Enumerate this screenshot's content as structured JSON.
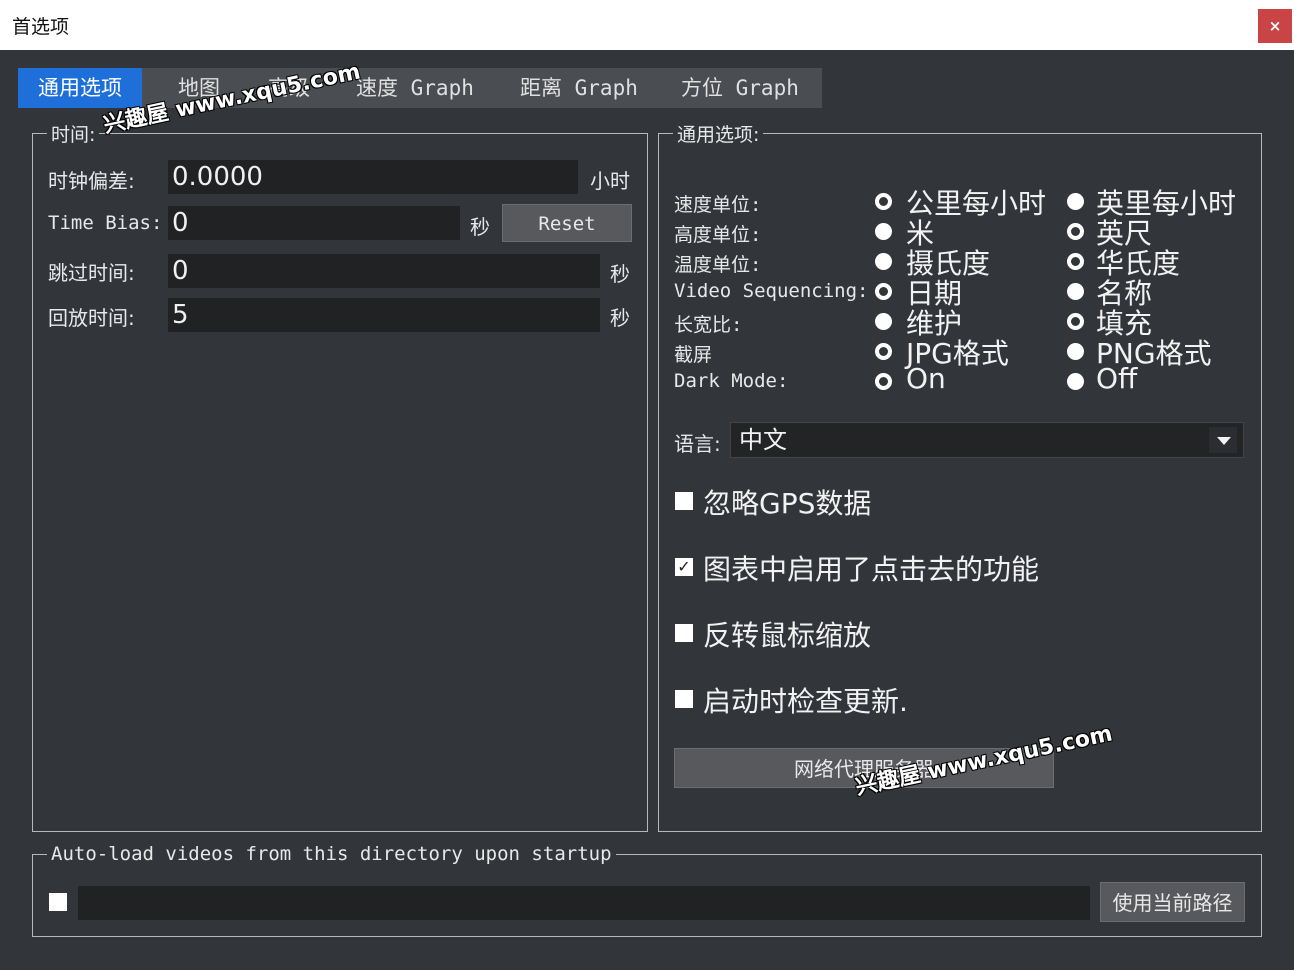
{
  "window": {
    "title": "首选项",
    "close_icon": "×"
  },
  "tabs": [
    "通用选项",
    "地图",
    "高级",
    "速度 Graph",
    "距离 Graph",
    "方位 Graph"
  ],
  "time_group": {
    "legend": "时间:",
    "clock_offset": {
      "label": "时钟偏差:",
      "value": "0.0000",
      "unit": "小时"
    },
    "time_bias": {
      "label": "Time Bias:",
      "value": "0",
      "unit": "秒",
      "reset_label": "Reset"
    },
    "skip_time": {
      "label": "跳过时间:",
      "value": "0",
      "unit": "秒"
    },
    "playback_time": {
      "label": "回放时间:",
      "value": "5",
      "unit": "秒"
    }
  },
  "general_group": {
    "legend": "通用选项:",
    "radio_rows": [
      {
        "label": "速度单位:",
        "opt1": "公里每小时",
        "opt2": "英里每小时",
        "selected": 1
      },
      {
        "label": "高度单位:",
        "opt1": "米",
        "opt2": "英尺",
        "selected": 2
      },
      {
        "label": "温度单位:",
        "opt1": "摄氏度",
        "opt2": "华氏度",
        "selected": 2
      },
      {
        "label": "Video Sequencing:",
        "opt1": "日期",
        "opt2": "名称",
        "selected": 1
      },
      {
        "label": "长宽比:",
        "opt1": "维护",
        "opt2": "填充",
        "selected": 2
      },
      {
        "label": "截屏",
        "opt1": "JPG格式",
        "opt2": "PNG格式",
        "selected": 1
      },
      {
        "label": "Dark Mode:",
        "opt1": "On",
        "opt2": "Off",
        "selected": 1
      }
    ],
    "language": {
      "label": "语言:",
      "value": "中文"
    },
    "checkboxes": [
      {
        "label": "忽略GPS数据",
        "checked": false
      },
      {
        "label": "图表中启用了点击去的功能",
        "checked": true
      },
      {
        "label": "反转鼠标缩放",
        "checked": false
      },
      {
        "label": "启动时检查更新.",
        "checked": false
      }
    ],
    "proxy_button": "网络代理服务器"
  },
  "autoload_group": {
    "legend": "Auto-load videos from this directory upon startup",
    "checked": false,
    "path_value": "",
    "use_current_path_label": "使用当前路径"
  },
  "watermarks": [
    "兴趣屋 www.xqu5.com",
    "兴趣屋 www.xqu5.com"
  ]
}
